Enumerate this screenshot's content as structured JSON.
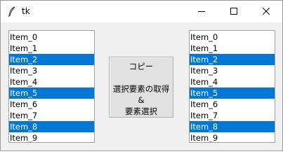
{
  "window": {
    "title": "tk"
  },
  "title_controls": {
    "minimize_icon": "minimize-icon",
    "maximize_icon": "maximize-icon",
    "close_icon": "close-icon"
  },
  "left_list": {
    "items": [
      {
        "label": "Item_0",
        "selected": false
      },
      {
        "label": "Item_1",
        "selected": false
      },
      {
        "label": "Item_2",
        "selected": true
      },
      {
        "label": "Item_3",
        "selected": false
      },
      {
        "label": "Item_4",
        "selected": false
      },
      {
        "label": "Item_5",
        "selected": true
      },
      {
        "label": "Item_6",
        "selected": false
      },
      {
        "label": "Item_7",
        "selected": false
      },
      {
        "label": "Item_8",
        "selected": true
      },
      {
        "label": "Item_9",
        "selected": false
      }
    ]
  },
  "right_list": {
    "items": [
      {
        "label": "Item_0",
        "selected": false
      },
      {
        "label": "Item_1",
        "selected": false
      },
      {
        "label": "Item_2",
        "selected": true
      },
      {
        "label": "Item_3",
        "selected": false
      },
      {
        "label": "Item_4",
        "selected": false
      },
      {
        "label": "Item_5",
        "selected": true
      },
      {
        "label": "Item_6",
        "selected": false
      },
      {
        "label": "Item_7",
        "selected": false
      },
      {
        "label": "Item_8",
        "selected": true
      },
      {
        "label": "Item_9",
        "selected": false
      }
    ]
  },
  "copy_button": {
    "lines": [
      "コピー",
      "",
      "選択要素の取得",
      "&",
      "要素選択"
    ]
  },
  "colors": {
    "selection_background": "#0078d7",
    "selection_text": "#ffffff",
    "window_background": "#f0f0f0"
  }
}
